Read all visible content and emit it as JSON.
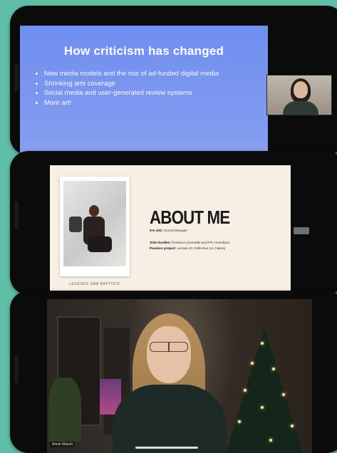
{
  "slide1": {
    "title": "How criticism has changed",
    "bullets": [
      "New media models and the rise of ad-funded digital media",
      "Shrinking arts coverage",
      "Social media and user-generated review systems",
      "More art!"
    ]
  },
  "slide2": {
    "title": "ABOUT ME",
    "lines": [
      {
        "label": "9-5 Job:",
        "text": "Social Manager"
      },
      {
        "label": "Side hustles:",
        "text": "freelance journalist and PR consultant"
      },
      {
        "label": "Passion project:",
        "text": "Lemak Art Collective (on hiatus)"
      }
    ],
    "photo_caption": "LEGENDS SAM BAPTISTE"
  },
  "participant": {
    "name_tag": "Annie Mason"
  }
}
